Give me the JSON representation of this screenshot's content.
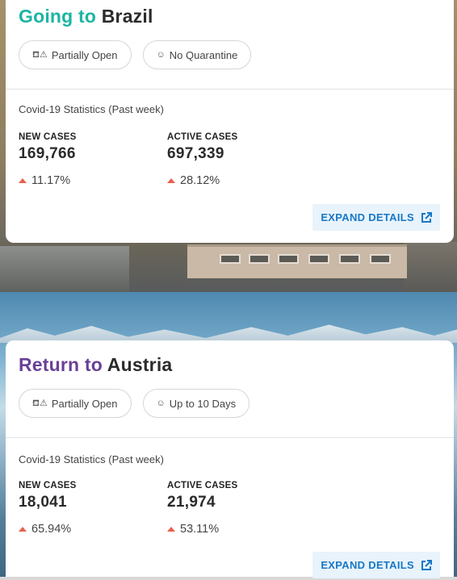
{
  "cards": [
    {
      "prefix": "Going to",
      "destination": "Brazil",
      "prefix_color": "#1cb5a3",
      "pills": [
        {
          "icon": "border-warning-icon",
          "glyph": "⛾⚠",
          "label": "Partially Open"
        },
        {
          "icon": "quarantine-icon",
          "glyph": "☺",
          "label": "No Quarantine"
        }
      ],
      "stats_label": "Covid-19 Statistics (Past week)",
      "stats": [
        {
          "title": "NEW CASES",
          "value": "169,766",
          "change": "11.17%"
        },
        {
          "title": "ACTIVE CASES",
          "value": "697,339",
          "change": "28.12%"
        }
      ],
      "expand_label": "EXPAND DETAILS"
    },
    {
      "prefix": "Return to",
      "destination": "Austria",
      "prefix_color": "#6a3f96",
      "pills": [
        {
          "icon": "border-warning-icon",
          "glyph": "⛾⚠",
          "label": "Partially Open"
        },
        {
          "icon": "quarantine-icon",
          "glyph": "☺",
          "label": "Up to 10 Days"
        }
      ],
      "stats_label": "Covid-19 Statistics (Past week)",
      "stats": [
        {
          "title": "NEW CASES",
          "value": "18,041",
          "change": "65.94%"
        },
        {
          "title": "ACTIVE CASES",
          "value": "21,974",
          "change": "53.11%"
        }
      ],
      "expand_label": "EXPAND DETAILS"
    }
  ],
  "colors": {
    "trend_up": "#e8604c",
    "button_text": "#1878c7",
    "button_bg": "#e8f3fb"
  }
}
